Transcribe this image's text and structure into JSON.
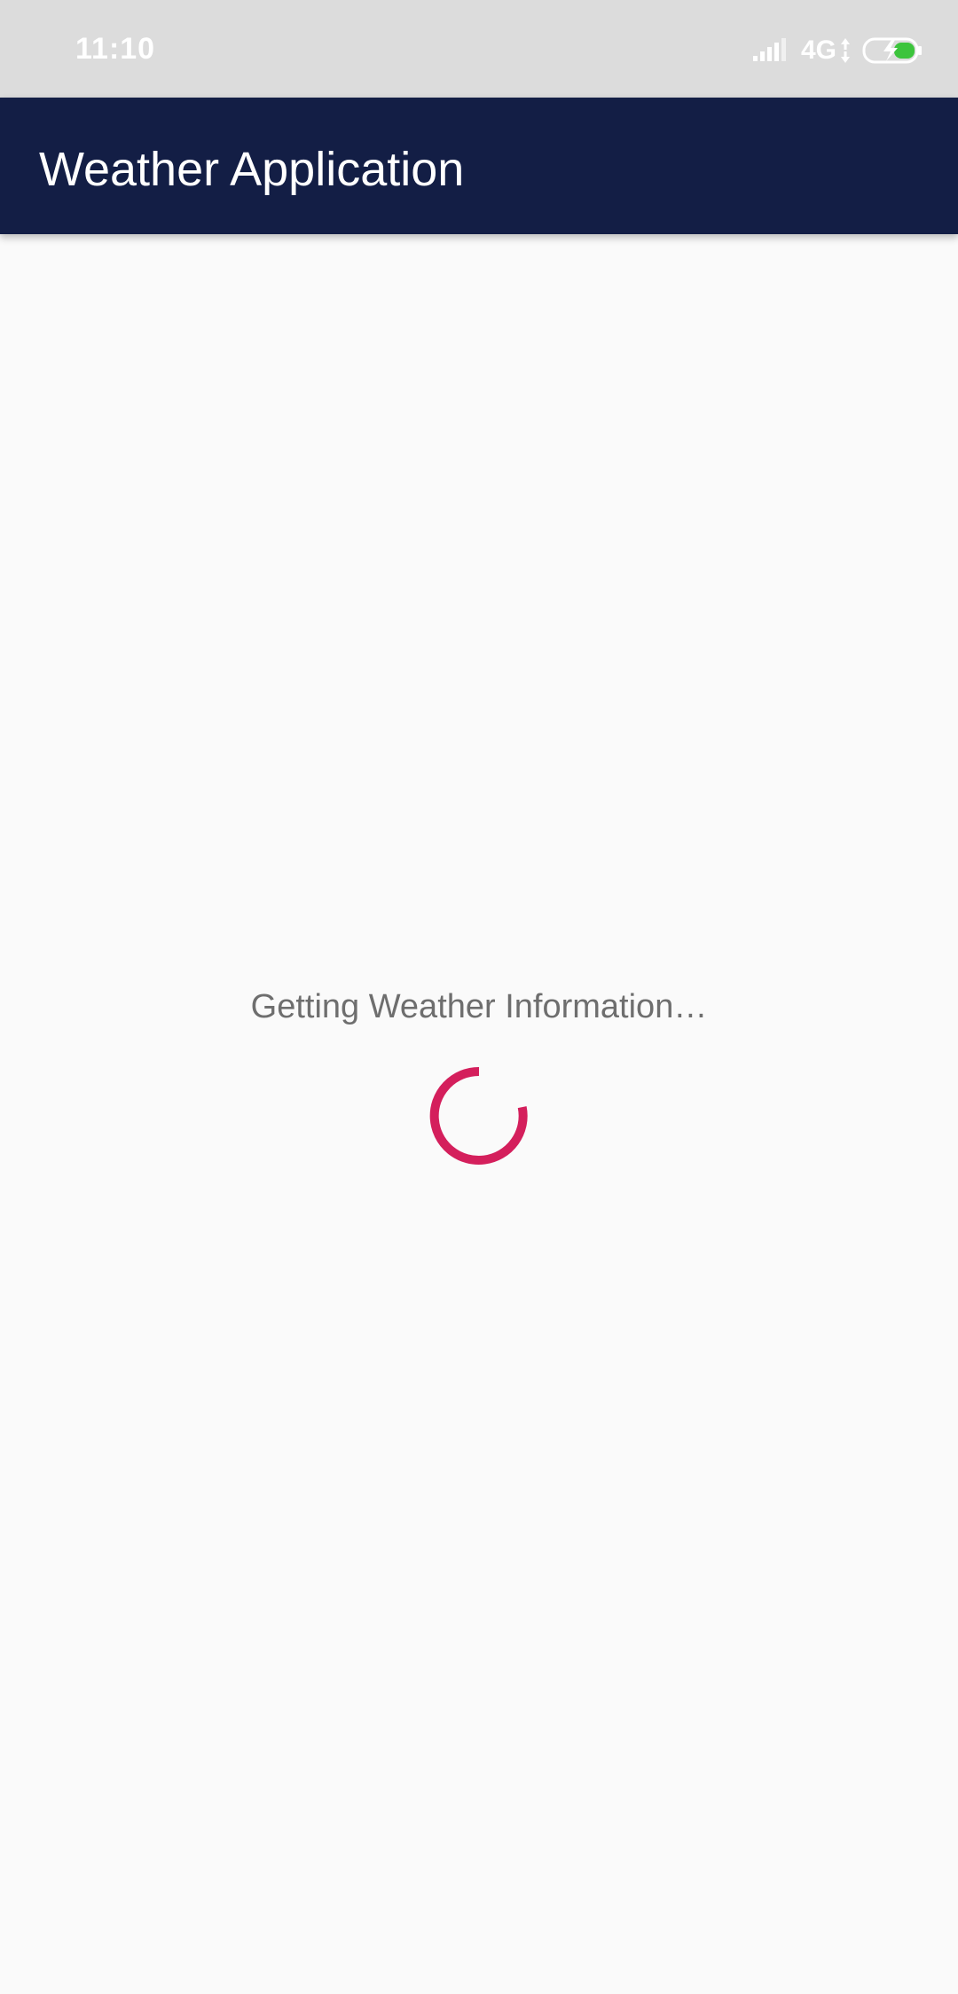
{
  "status_bar": {
    "time": "11:10",
    "network": "4G",
    "icons": [
      "signal-icon",
      "data-arrows-icon",
      "battery-charging-icon"
    ],
    "battery_color": "#3cc43c"
  },
  "app_bar": {
    "title": "Weather Application",
    "background": "#131e45"
  },
  "main": {
    "loading_text": "Getting Weather Information…",
    "spinner_color": "#d41f5c"
  }
}
